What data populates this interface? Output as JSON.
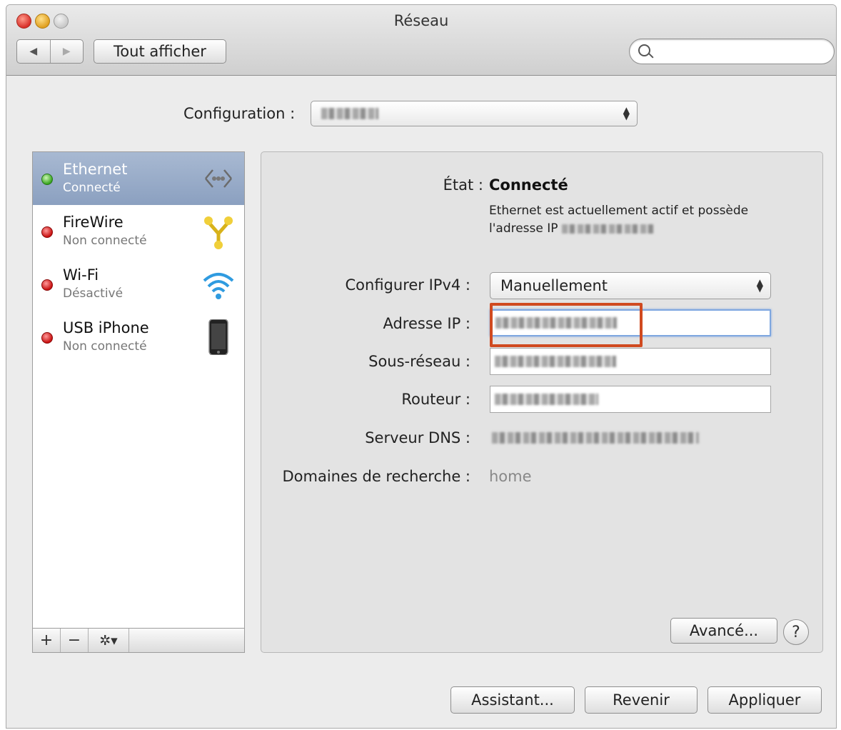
{
  "window": {
    "title": "Réseau"
  },
  "toolbar": {
    "back_glyph": "◀",
    "forward_glyph": "▶",
    "show_all_label": "Tout afficher",
    "search_placeholder": ""
  },
  "configuration": {
    "label": "Configuration :",
    "value_obscured": true
  },
  "services": [
    {
      "name": "Ethernet",
      "status": "Connecté",
      "status_color": "green",
      "selected": true,
      "icon": "ethernet-icon"
    },
    {
      "name": "FireWire",
      "status": "Non connecté",
      "status_color": "red",
      "selected": false,
      "icon": "firewire-icon"
    },
    {
      "name": "Wi-Fi",
      "status": "Désactivé",
      "status_color": "red",
      "selected": false,
      "icon": "wifi-icon"
    },
    {
      "name": "USB iPhone",
      "status": "Non connecté",
      "status_color": "red",
      "selected": false,
      "icon": "iphone-icon"
    }
  ],
  "sidebar_toolbar": {
    "add": "+",
    "remove": "−",
    "gear": "✲▾"
  },
  "details": {
    "state_label": "État :",
    "state_value": "Connecté",
    "description_text": "Ethernet est actuellement actif et possède l'adresse IP",
    "configure_ipv4_label": "Configurer IPv4 :",
    "configure_ipv4_value": "Manuellement",
    "ip_label": "Adresse IP :",
    "subnet_label": "Sous-réseau :",
    "router_label": "Routeur :",
    "dns_label": "Serveur DNS :",
    "search_domains_label": "Domaines de recherche :",
    "search_domains_value": "home"
  },
  "buttons": {
    "advanced": "Avancé...",
    "help": "?",
    "assistant": "Assistant...",
    "revert": "Revenir",
    "apply": "Appliquer"
  },
  "colors": {
    "highlight_box": "#d04a20",
    "selection": "#8ba0c0",
    "status_green": "#38a51e",
    "status_red": "#c81010"
  }
}
